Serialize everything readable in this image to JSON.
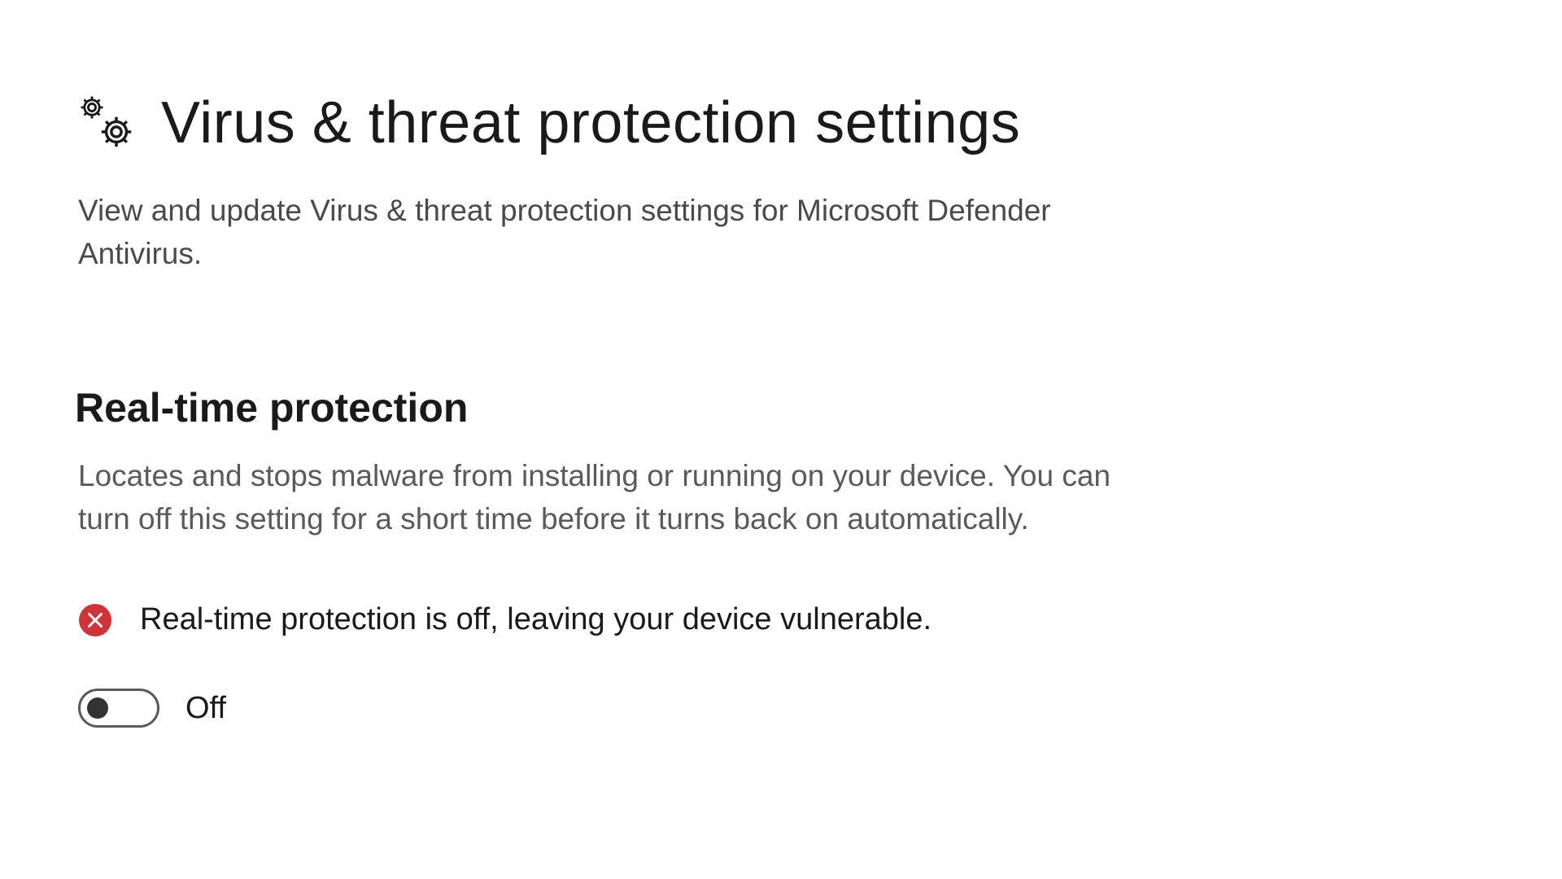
{
  "header": {
    "icon": "gears-icon",
    "title": "Virus & threat protection settings",
    "subtitle": "View and update Virus & threat protection settings for Microsoft Defender Antivirus."
  },
  "realtime_protection": {
    "heading": "Real-time protection",
    "description": "Locates and stops malware from installing or running on your device. You can turn off this setting for a short time before it turns back on automatically.",
    "warning": {
      "icon": "error-circle-icon",
      "text": "Real-time protection is off, leaving your device vulnerable."
    },
    "toggle": {
      "state": "off",
      "label": "Off"
    }
  },
  "colors": {
    "error": "#d13438",
    "text": "#1a1a1a",
    "secondary_text": "#5a5a5a"
  }
}
